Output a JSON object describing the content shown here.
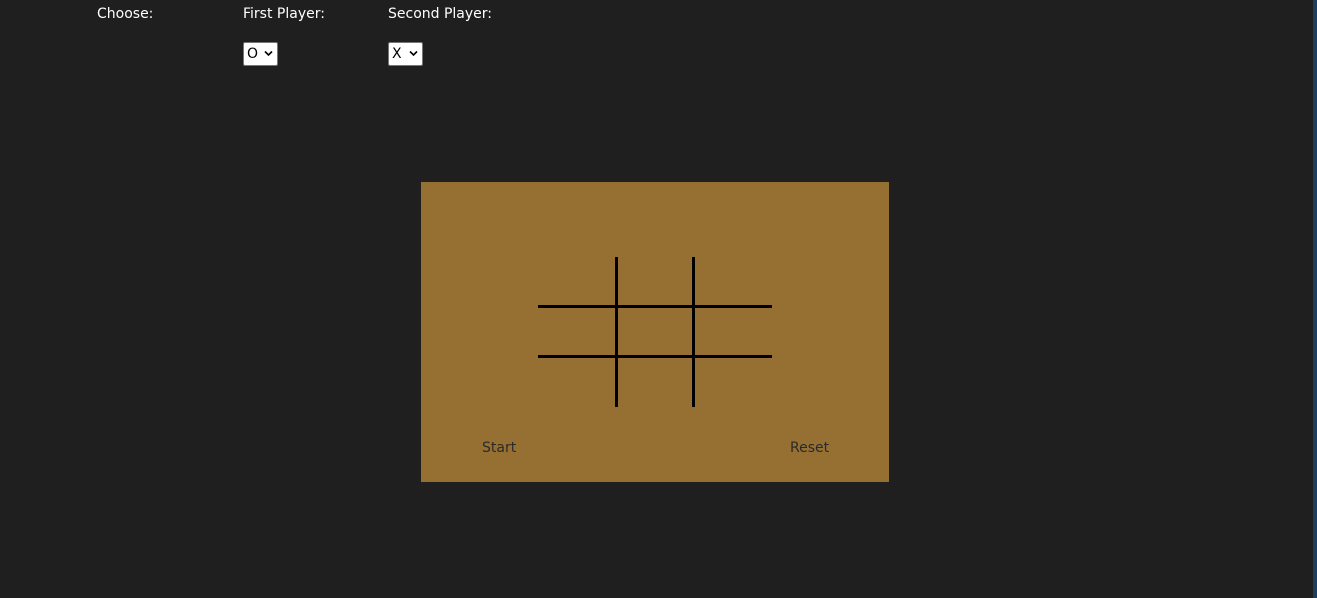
{
  "labels": {
    "choose": "Choose:",
    "first_player": "First Player:",
    "second_player": "Second Player:"
  },
  "first_player_select": {
    "value": "O",
    "options": [
      "O"
    ]
  },
  "second_player_select": {
    "value": "X",
    "options": [
      "X"
    ]
  },
  "board": {
    "cells": [
      "",
      "",
      "",
      "",
      "",
      "",
      "",
      "",
      ""
    ]
  },
  "buttons": {
    "start": "Start",
    "reset": "Reset"
  },
  "colors": {
    "page_background": "#1f1f1f",
    "board_background": "#967032",
    "grid_lines": "#000000",
    "label_text": "#ffffff",
    "button_text": "#2a2a2a"
  },
  "icons": {
    "select_arrow": "chevron-down-icon"
  }
}
